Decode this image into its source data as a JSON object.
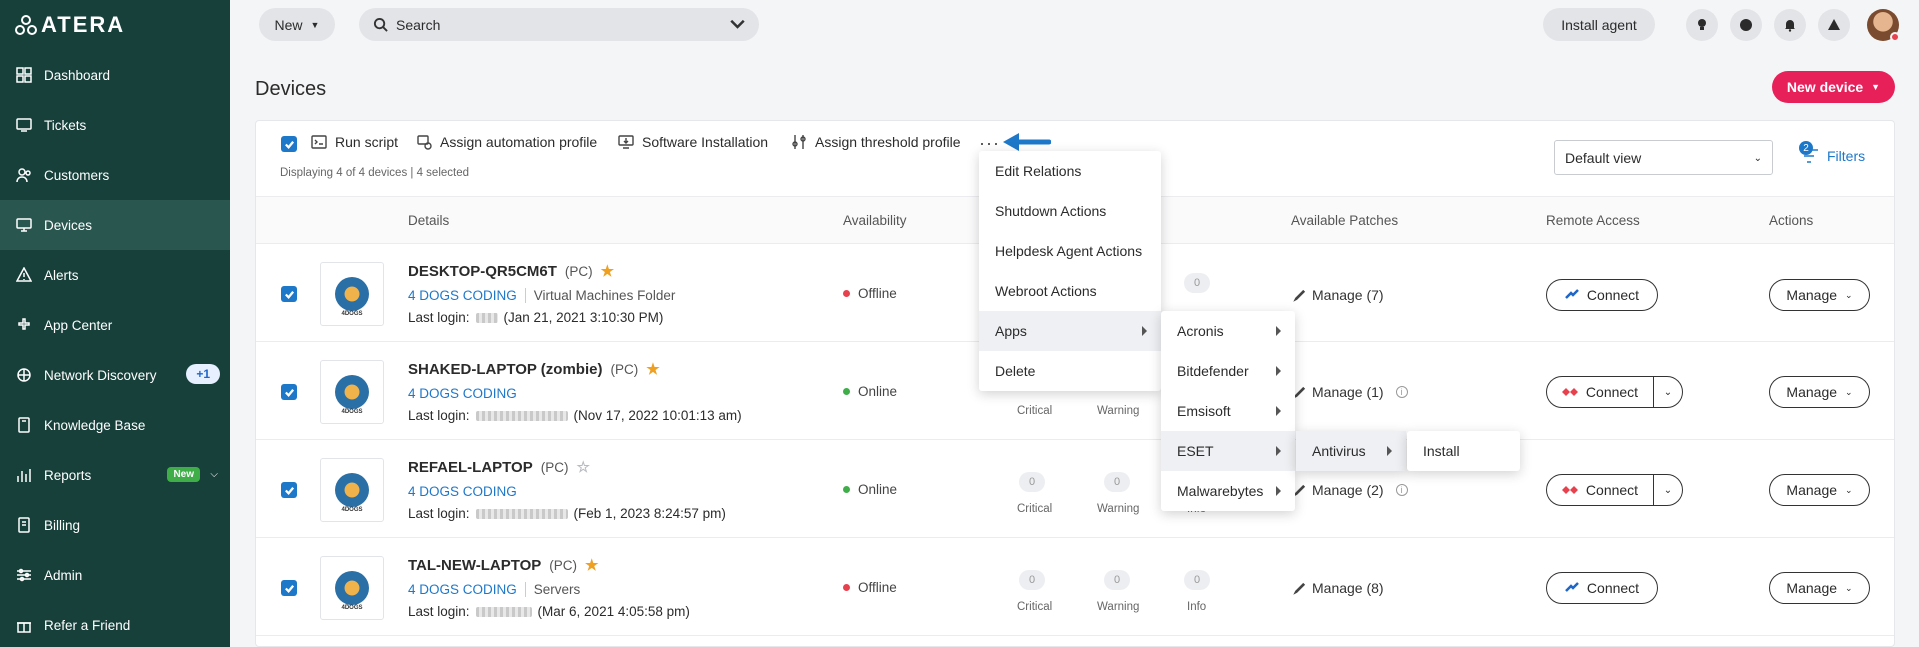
{
  "logo": {
    "text": "ATERA"
  },
  "sidebar": {
    "items": [
      {
        "label": "Dashboard",
        "icon": "dashboard-icon"
      },
      {
        "label": "Tickets",
        "icon": "tickets-icon"
      },
      {
        "label": "Customers",
        "icon": "customers-icon"
      },
      {
        "label": "Devices",
        "icon": "devices-icon",
        "active": true
      },
      {
        "label": "Alerts",
        "icon": "alerts-icon"
      },
      {
        "label": "App Center",
        "icon": "app-center-icon"
      },
      {
        "label": "Network Discovery",
        "icon": "network-icon",
        "badge": "+1"
      },
      {
        "label": "Knowledge Base",
        "icon": "book-icon"
      },
      {
        "label": "Reports",
        "icon": "reports-icon",
        "tag": "New"
      },
      {
        "label": "Billing",
        "icon": "billing-icon"
      },
      {
        "label": "Admin",
        "icon": "admin-icon"
      },
      {
        "label": "Refer a Friend",
        "icon": "gift-icon"
      }
    ]
  },
  "topbar": {
    "new_label": "New",
    "search_placeholder": "Search",
    "install_agent_label": "Install agent"
  },
  "page": {
    "title": "Devices",
    "new_device_label": "New device"
  },
  "toolbar": {
    "run_script": "Run script",
    "assign_automation": "Assign automation profile",
    "software_installation": "Software Installation",
    "assign_threshold": "Assign threshold profile",
    "more": "···",
    "displaying": "Displaying 4 of 4 devices | 4 selected",
    "view_select": "Default view",
    "filters_label": "Filters",
    "filters_count": "2"
  },
  "columns": {
    "details": "Details",
    "availability": "Availability",
    "available_patches": "Available Patches",
    "remote_access": "Remote Access",
    "actions": "Actions"
  },
  "devices": [
    {
      "name": "DESKTOP-QR5CM6T",
      "type": "(PC)",
      "starred": true,
      "customer": "4 DOGS CODING",
      "folder": "Virtual Machines Folder",
      "login_label": "Last login:",
      "login_time": "(Jan 21, 2021 3:10:30 PM)",
      "status": "Offline",
      "patches": "Manage  (7)",
      "connect": "Connect",
      "manage": "Manage"
    },
    {
      "name": "SHAKED-LAPTOP (zombie)",
      "type": "(PC)",
      "starred": true,
      "customer": "4 DOGS CODING",
      "folder": "",
      "login_label": "Last login:",
      "login_time": "(Nov 17, 2022 10:01:13 am)",
      "status": "Online",
      "critical": "Critical",
      "warning": "Warning",
      "patches": "Manage  (1)",
      "connect": "Connect",
      "manage": "Manage"
    },
    {
      "name": "REFAEL-LAPTOP",
      "type": "(PC)",
      "starred": false,
      "customer": "4 DOGS CODING",
      "folder": "",
      "login_label": "Last login:",
      "login_time": "(Feb 1, 2023 8:24:57 pm)",
      "status": "Online",
      "critical_val": "0",
      "warning_val": "0",
      "critical": "Critical",
      "warning": "Warning",
      "info": "Info",
      "patches": "Manage  (2)",
      "connect": "Connect",
      "manage": "Manage"
    },
    {
      "name": "TAL-NEW-LAPTOP",
      "type": "(PC)",
      "starred": true,
      "customer": "4 DOGS CODING",
      "folder": "Servers",
      "login_label": "Last login:",
      "login_time": "(Mar 6, 2021 4:05:58 pm)",
      "status": "Offline",
      "critical_val": "0",
      "warning_val": "0",
      "info_val": "0",
      "critical": "Critical",
      "warning": "Warning",
      "info": "Info",
      "patches": "Manage  (8)",
      "connect": "Connect",
      "manage": "Manage"
    }
  ],
  "row1_info_val": "0",
  "logo_text_small": "4DOGS",
  "context_menu": {
    "items": [
      "Edit Relations",
      "Shutdown Actions",
      "Helpdesk Agent Actions",
      "Webroot Actions",
      "Apps",
      "Delete"
    ]
  },
  "apps_menu": {
    "items": [
      "Acronis",
      "Bitdefender",
      "Emsisoft",
      "ESET",
      "Malwarebytes"
    ]
  },
  "eset_menu": {
    "items": [
      "Antivirus"
    ]
  },
  "antivirus_menu": {
    "items": [
      "Install"
    ]
  },
  "colors": {
    "sidebar": "#17403b",
    "accent": "#e8205a",
    "link": "#1e78c9",
    "offline": "#e8414e",
    "online": "#3fae49"
  }
}
